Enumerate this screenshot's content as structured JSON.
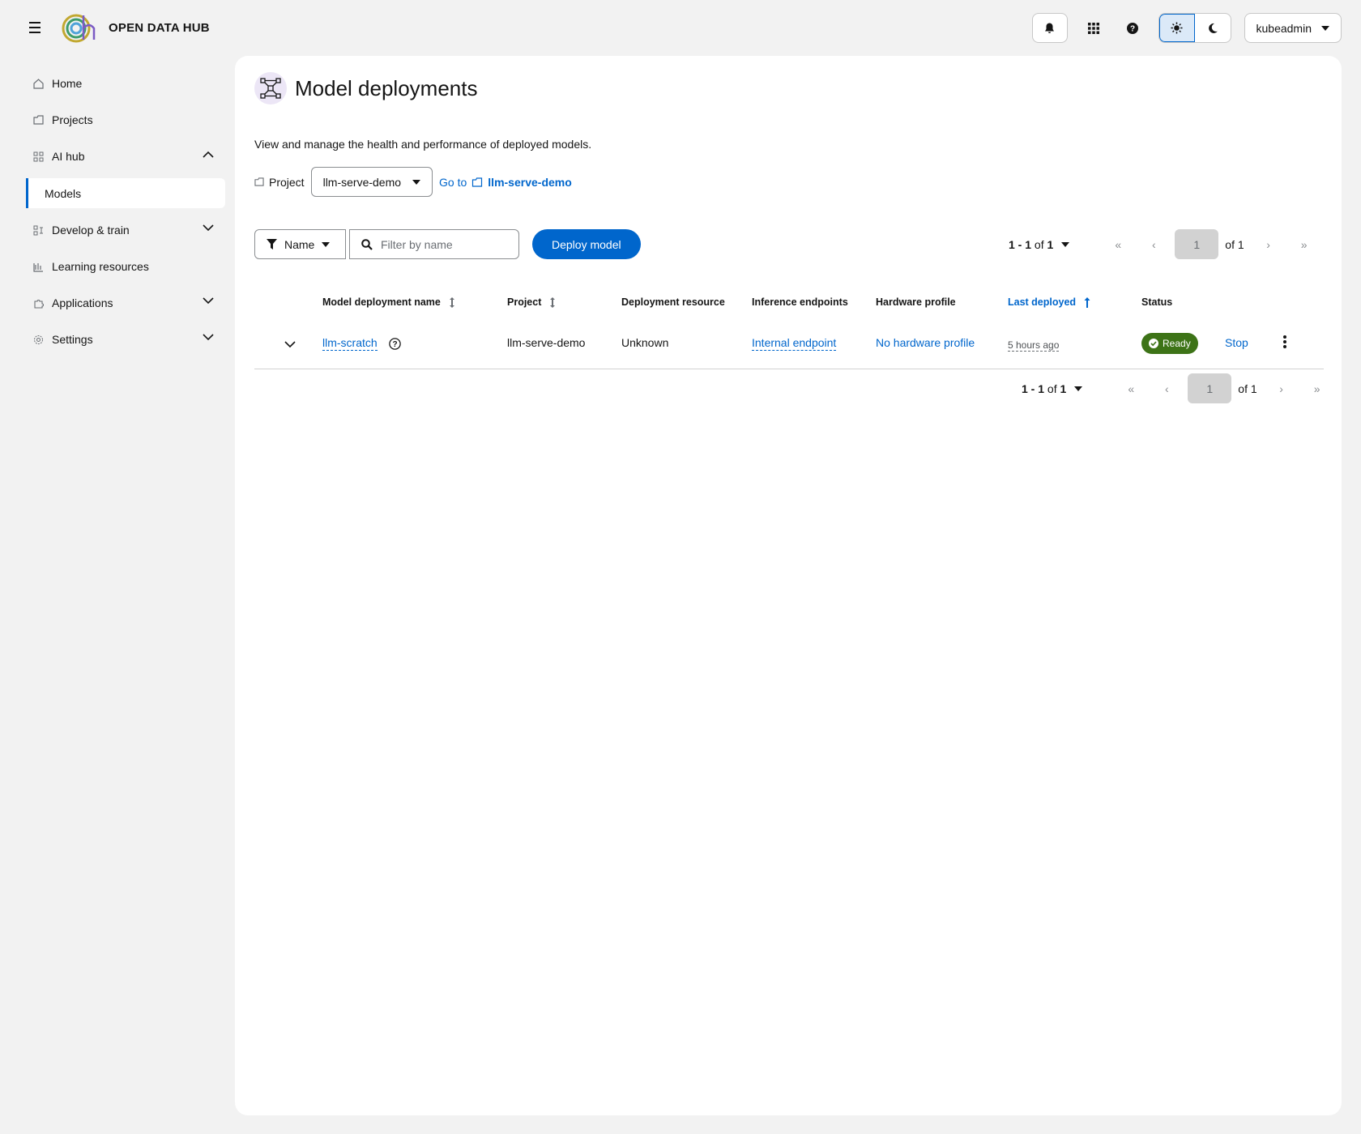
{
  "brand": {
    "name_bold": "OPEN",
    "name_rest": "DATA HUB"
  },
  "header": {
    "user": "kubeadmin"
  },
  "sidebar": {
    "items": [
      {
        "label": "Home"
      },
      {
        "label": "Projects"
      },
      {
        "label": "AI hub"
      },
      {
        "label": "Models"
      },
      {
        "label": "Develop & train"
      },
      {
        "label": "Learning resources"
      },
      {
        "label": "Applications"
      },
      {
        "label": "Settings"
      }
    ]
  },
  "page": {
    "title": "Model deployments",
    "description": "View and manage the health and performance of deployed models.",
    "project_label": "Project",
    "project_selected": "llm-serve-demo",
    "goto_label": "Go to",
    "goto_project": "llm-serve-demo"
  },
  "toolbar": {
    "filter_label": "Name",
    "search_placeholder": "Filter by name",
    "deploy_label": "Deploy model"
  },
  "pagination": {
    "range": "1 - 1",
    "of_label": "of",
    "total": "1",
    "page": "1",
    "of_pages": "of 1"
  },
  "table": {
    "columns": [
      "Model deployment name",
      "Project",
      "Deployment resource",
      "Inference endpoints",
      "Hardware profile",
      "Last deployed",
      "Status"
    ],
    "rows": [
      {
        "name": "llm-scratch",
        "project": "llm-serve-demo",
        "resource": "Unknown",
        "endpoint": "Internal endpoint",
        "hardware": "No hardware profile",
        "last_deployed": "5 hours ago",
        "status": "Ready",
        "action": "Stop"
      }
    ]
  },
  "colors": {
    "primary": "#0066cc",
    "success": "#3d7317",
    "background": "#f2f2f2"
  },
  "icons": [
    "hamburger-icon",
    "bell-icon",
    "grid-icon",
    "help-icon",
    "sun-icon",
    "moon-icon",
    "home-icon",
    "folder-icon",
    "ai-hub-icon",
    "develop-icon",
    "learning-icon",
    "puzzle-icon",
    "gear-icon",
    "model-icon",
    "filter-icon",
    "search-icon",
    "sort-icon",
    "chevron-down-icon",
    "kebab-icon",
    "check-circle-icon"
  ]
}
